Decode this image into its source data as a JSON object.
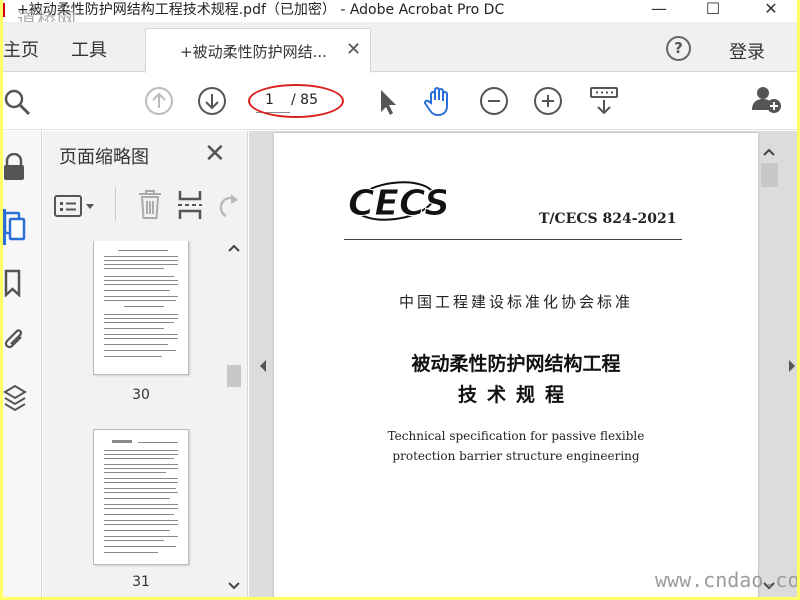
{
  "window": {
    "title": "+被动柔性防护网结构工程技术规程.pdf（已加密） - Adobe Acrobat Pro DC",
    "minimize": "—",
    "maximize": "☐",
    "close": "✕"
  },
  "watermarks": {
    "top_left": "道桥网",
    "bottom_right": "www.cndao.com"
  },
  "tabs": {
    "home": "主页",
    "tools": "工具",
    "document": "+被动柔性防护网结...",
    "doc_close": "✕"
  },
  "header": {
    "help": "?",
    "login": "登录"
  },
  "toolbar": {
    "current_page": "1",
    "total_pages": "/ 85"
  },
  "thumbnails_panel": {
    "title": "页面缩略图",
    "close": "✕",
    "pages": [
      {
        "number": "30"
      },
      {
        "number": "31"
      }
    ]
  },
  "document": {
    "logo_text": "CECS",
    "standard_no": "T/CECS 824-2021",
    "org": "中国工程建设标准化协会标准",
    "title_line1": "被动柔性防护网结构工程",
    "title_line2": "技术规程",
    "en_line1": "Technical specification for passive flexible",
    "en_line2": "protection barrier structure engineering"
  },
  "colors": {
    "annotation_red": "#d9201a",
    "active_blue": "#2b6fd6",
    "frame_yellow": "#ffff66"
  }
}
